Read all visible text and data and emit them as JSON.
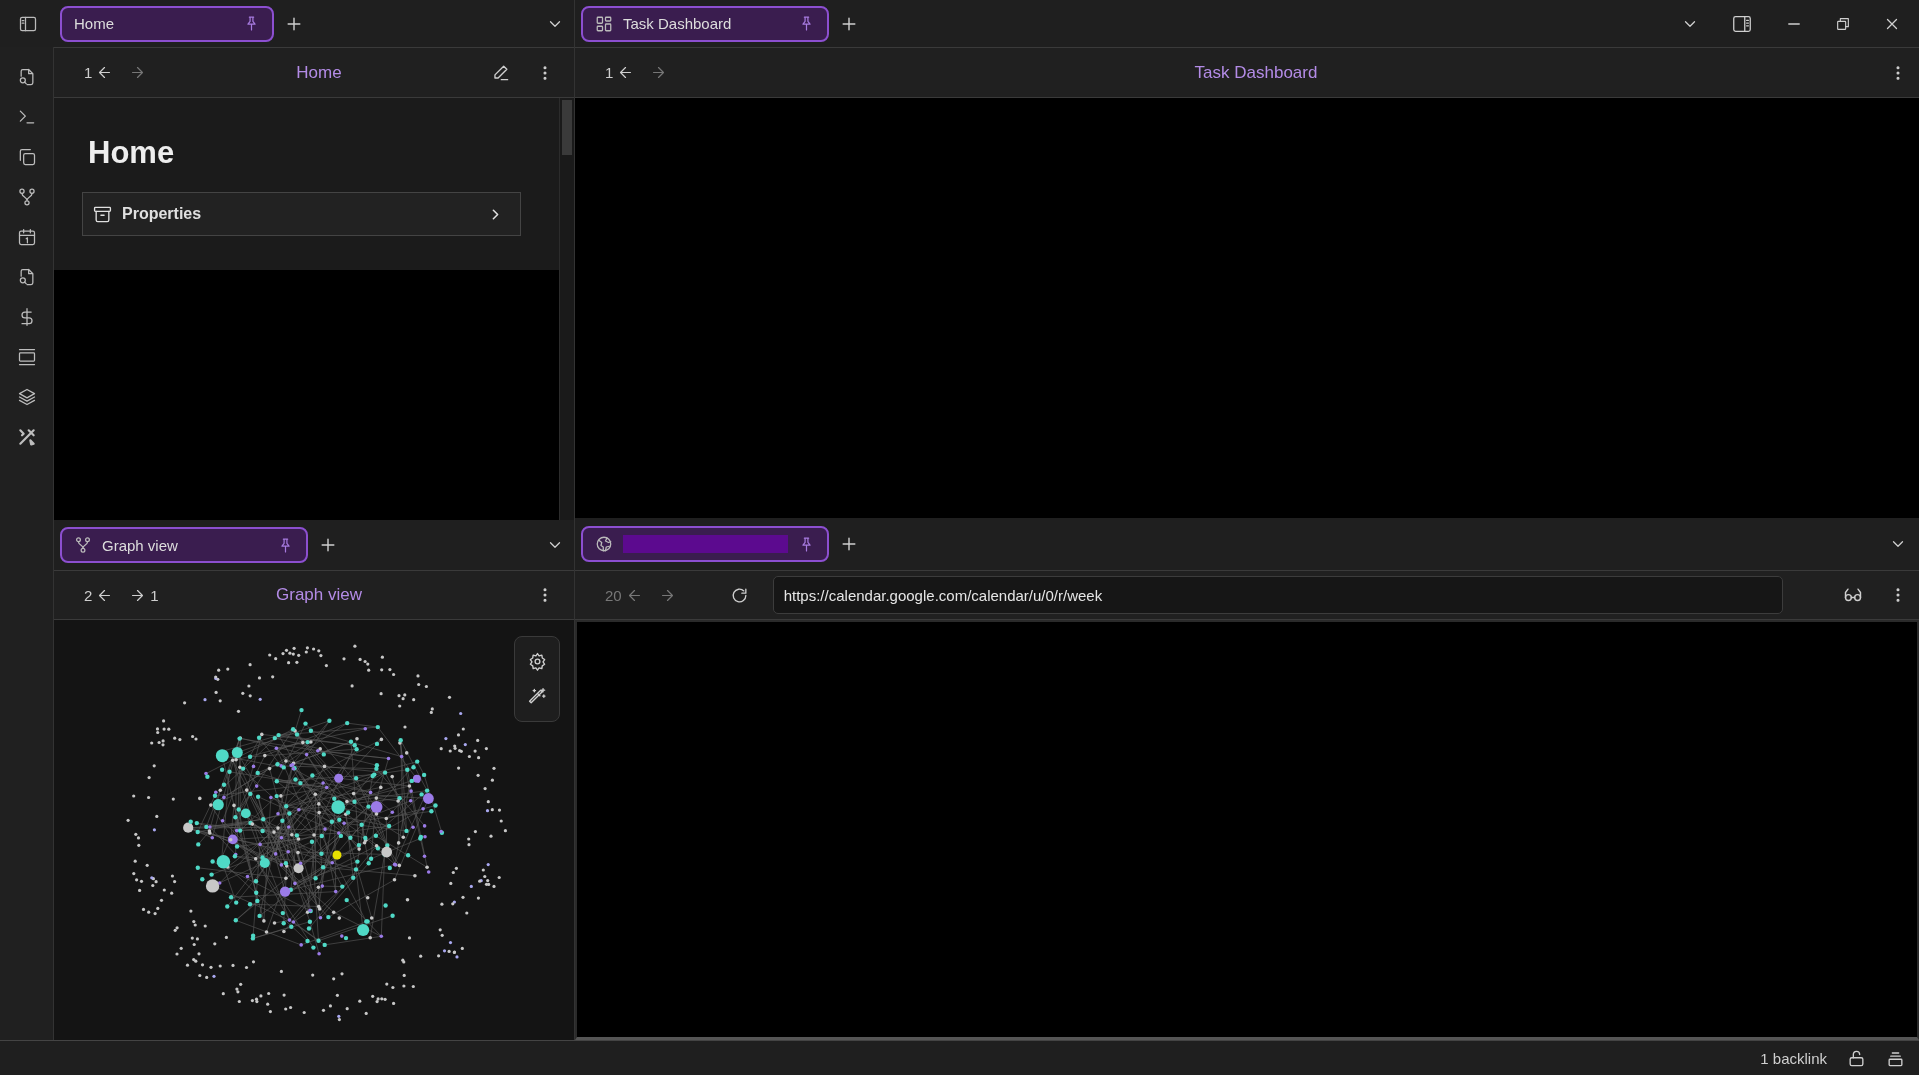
{
  "top_tabs_left": [
    {
      "title": "Home",
      "selected": true
    }
  ],
  "top_tabs_right": [
    {
      "title": "Task Dashboard",
      "selected": true
    }
  ],
  "home_pane": {
    "back_count": "1",
    "title": "Home",
    "note_title": "Home",
    "properties_label": "Properties"
  },
  "dashboard_pane": {
    "back_count": "1",
    "title": "Task Dashboard"
  },
  "graph_tabs": [
    {
      "title": "Graph view",
      "selected": true
    }
  ],
  "graph_pane": {
    "back_count": "2",
    "forward_count": "1",
    "title": "Graph view"
  },
  "web_tabs": [
    {
      "selected": true
    }
  ],
  "web_pane": {
    "back_count": "20",
    "url": "https://calendar.google.com/calendar/u/0/r/week"
  },
  "status_bar": {
    "backlinks": "1 backlink"
  }
}
